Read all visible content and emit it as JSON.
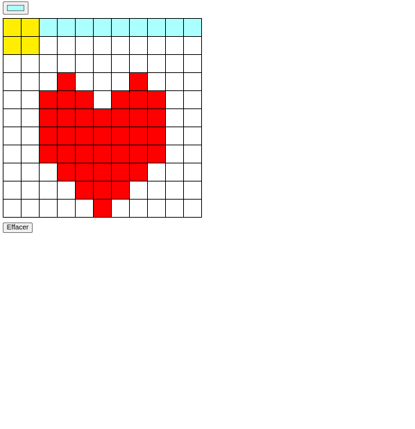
{
  "color_picker": {
    "value": "#aaffff"
  },
  "grid": {
    "rows": 11,
    "cols": 11,
    "palette": {
      "W": "#ffffff",
      "C": "#aaffff",
      "Y": "#ffee00",
      "R": "#ff0000"
    },
    "cells": [
      "YYCCCCCCCCC",
      "YYWWWWWWWWW",
      "WWWWWWWWWWW",
      "WWWRWWWRWWW",
      "WWRRRWRRRWW",
      "WWRRRRRRRWW",
      "WWRRRRRRRWW",
      "WWRRRRRRRWW",
      "WWWRRRRRWWW",
      "WWWWRRRWWWW",
      "WWWWWRWWWWW"
    ]
  },
  "clear_button": {
    "label": "Effacer"
  }
}
